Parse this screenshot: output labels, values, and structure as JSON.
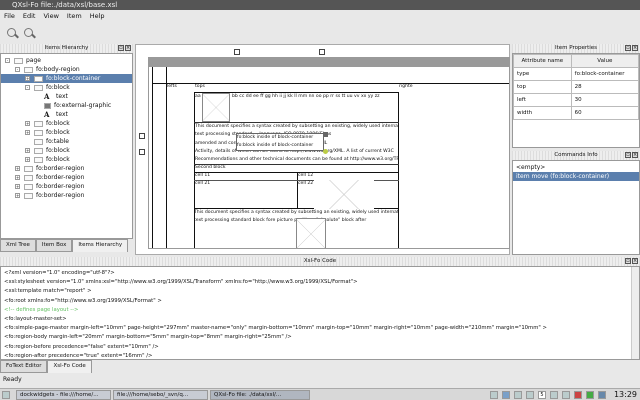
{
  "window": {
    "title": "QXsl-Fo file:./data/xsl/base.xsl"
  },
  "menu": [
    "File",
    "Edit",
    "View",
    "Item",
    "Help"
  ],
  "toolbar": {
    "zoom_in": "zoom-in-icon",
    "zoom_out": "zoom-out-icon"
  },
  "left_dock": {
    "title": "Items Hierarchy",
    "tree": [
      {
        "label": "page",
        "level": 0,
        "exp": "-",
        "icon": "page"
      },
      {
        "label": "fo:body-region",
        "level": 1,
        "exp": "-",
        "icon": "region"
      },
      {
        "label": "fo:block-container",
        "level": 2,
        "exp": "+",
        "icon": "block",
        "selected": true
      },
      {
        "label": "fo:block",
        "level": 2,
        "exp": "-",
        "icon": "block"
      },
      {
        "label": "text",
        "level": 3,
        "icon": "text"
      },
      {
        "label": "fo:external-graphic",
        "level": 3,
        "icon": "graphic"
      },
      {
        "label": "text",
        "level": 3,
        "icon": "text"
      },
      {
        "label": "fo:block",
        "level": 2,
        "exp": "+",
        "icon": "block"
      },
      {
        "label": "fo:block",
        "level": 2,
        "exp": "+",
        "icon": "block"
      },
      {
        "label": "fo:table",
        "level": 2,
        "icon": "table"
      },
      {
        "label": "fo:block",
        "level": 2,
        "exp": "+",
        "icon": "block"
      },
      {
        "label": "fo:block",
        "level": 2,
        "exp": "+",
        "icon": "block"
      },
      {
        "label": "fo:border-region",
        "level": 1,
        "exp": "+",
        "icon": "region"
      },
      {
        "label": "fo:border-region",
        "level": 1,
        "exp": "+",
        "icon": "region"
      },
      {
        "label": "fo:border-region",
        "level": 1,
        "exp": "+",
        "icon": "region"
      },
      {
        "label": "fo:border-region",
        "level": 1,
        "exp": "+",
        "icon": "region"
      }
    ],
    "tabs": [
      "Xml Tree",
      "Item Box",
      "Items Hierarchy"
    ],
    "active_tab": 2
  },
  "canvas": {
    "left_label": "lefts",
    "top_label": "tops",
    "right_label": "righte",
    "line1_prefix": "aa",
    "line1": "bb cc dd ee ff gg hh ii jj kk ll mm nn oo pp rr ss tt uu vv xx yy zz",
    "para1": [
      "This document specifies a syntax created by subsetting an existing, widely used international",
      "text processing standard ... language, ISO 8879-1986(E) as",
      "amended and corrected ... It is a product of the W3C XML",
      "Activity, details of which can be found at http://www.w3.org/XML. A list of current W3C",
      "Recommendations and other technical documents can be found at http://www.w3.org/TR."
    ],
    "overlay": [
      "fo:block inside of block-container",
      "fo:block inside of block-container"
    ],
    "second_block": "Second block",
    "cells": [
      "cell 11",
      "cell 12",
      "cell 21",
      "cell 22"
    ],
    "para2": [
      "This document specifies a syntax created by subsetting an existing, widely used international",
      "text processing standard block fore picture          position=\"absolute\" block after"
    ]
  },
  "properties": {
    "title": "Item Properties",
    "headers": [
      "Attribute name",
      "Value"
    ],
    "rows": [
      [
        "type",
        "fo:block-container"
      ],
      [
        "top",
        "28"
      ],
      [
        "left",
        "30"
      ],
      [
        "width",
        "60"
      ]
    ]
  },
  "commands": {
    "title": "Commands Info",
    "items": [
      "<empty>",
      "item move (fo:block-container)"
    ],
    "selected": 1
  },
  "code_dock": {
    "title": "Xsl-Fo Code",
    "lines": [
      {
        "t": "<?xml version=\"1.0\" encoding=\"utf-8\"?>",
        "c": ""
      },
      {
        "t": "<xsl:stylesheet version=\"1.0\" xmlns:xsl=\"http://www.w3.org/1999/XSL/Transform\" xmlns:fo=\"http://www.w3.org/1999/XSL/Format\">",
        "c": ""
      },
      {
        "t": " <xsl:template match=\"report\" >",
        "c": ""
      },
      {
        "t": "  <fo:root xmlns:fo=\"http://www.w3.org/1999/XSL/Format\" >",
        "c": ""
      },
      {
        "t": "   <!-- defines page layout -->",
        "c": "comment"
      },
      {
        "t": "   <fo:layout-master-set>",
        "c": ""
      },
      {
        "t": "    <fo:simple-page-master margin-left=\"10mm\" page-height=\"297mm\" master-name=\"only\" margin-bottom=\"10mm\" margin-top=\"10mm\" margin-right=\"10mm\" page-width=\"210mm\" margin=\"10mm\" >",
        "c": ""
      },
      {
        "t": "     <fo:region-body margin-left=\"20mm\" margin-bottom=\"5mm\" margin-top=\"8mm\" margin-right=\"25mm\" />",
        "c": ""
      },
      {
        "t": "     <fo:region-before precedence=\"false\" extent=\"10mm\" />",
        "c": ""
      },
      {
        "t": "     <fo:region-after precedence=\"true\" extent=\"16mm\" />",
        "c": ""
      }
    ],
    "tabs": [
      "FoText Editor",
      "Xsl-Fo Code"
    ],
    "active_tab": 1
  },
  "status": "Ready",
  "taskbar": {
    "tasks": [
      "dockwidgets - file:///home/...",
      "file:///home/sebo/_svn/q...",
      "QXsl-Fo file: ./data/xsl/..."
    ],
    "pager": "5",
    "clock": "13:29"
  },
  "colors": {
    "selection": "#5b7fad",
    "comment": "#5fbf5f"
  }
}
